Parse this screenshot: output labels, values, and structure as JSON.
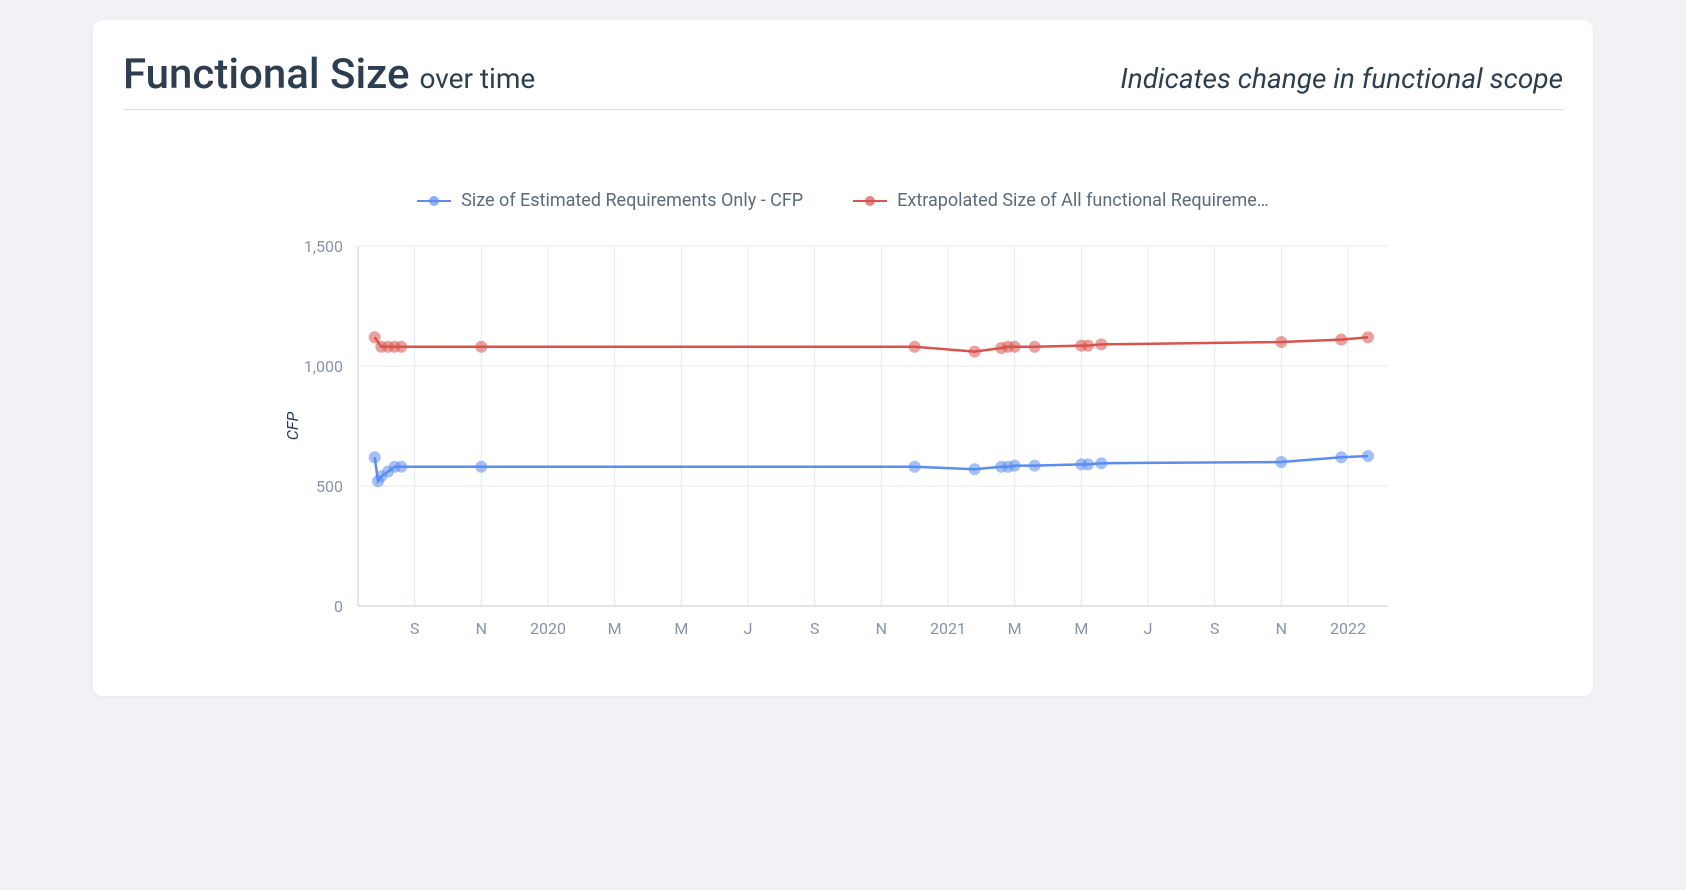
{
  "header": {
    "title_main": "Functional Size",
    "title_sub": "over time",
    "subtitle_right": "Indicates change in functional scope"
  },
  "chart_data": {
    "type": "line",
    "ylabel": "CFP",
    "xlabel": "",
    "ylim": [
      0,
      1500
    ],
    "y_ticks": [
      0,
      500,
      1000,
      1500
    ],
    "x_categories": [
      "S",
      "N",
      "2020",
      "M",
      "M",
      "J",
      "S",
      "N",
      "2021",
      "M",
      "M",
      "J",
      "S",
      "N",
      "2022"
    ],
    "legend": [
      "Size of Estimated Requirements Only - CFP",
      "Extrapolated Size of All functional Requireme…"
    ],
    "series": [
      {
        "name": "Size of Estimated Requirements Only - CFP",
        "color": "#5b8def",
        "points": [
          {
            "xi": -0.6,
            "y": 620
          },
          {
            "xi": -0.55,
            "y": 520
          },
          {
            "xi": -0.5,
            "y": 540
          },
          {
            "xi": -0.4,
            "y": 560
          },
          {
            "xi": -0.3,
            "y": 580
          },
          {
            "xi": -0.2,
            "y": 580
          },
          {
            "xi": 1,
            "y": 580
          },
          {
            "xi": 7.5,
            "y": 580
          },
          {
            "xi": 8.4,
            "y": 570
          },
          {
            "xi": 8.8,
            "y": 580
          },
          {
            "xi": 8.9,
            "y": 580
          },
          {
            "xi": 9.0,
            "y": 585
          },
          {
            "xi": 9.3,
            "y": 585
          },
          {
            "xi": 10.0,
            "y": 590
          },
          {
            "xi": 10.1,
            "y": 590
          },
          {
            "xi": 10.3,
            "y": 595
          },
          {
            "xi": 13.0,
            "y": 600
          },
          {
            "xi": 13.9,
            "y": 620
          },
          {
            "xi": 14.3,
            "y": 625
          }
        ]
      },
      {
        "name": "Extrapolated Size of All functional Requirements - CFP",
        "color": "#d9534f",
        "points": [
          {
            "xi": -0.6,
            "y": 1120
          },
          {
            "xi": -0.5,
            "y": 1080
          },
          {
            "xi": -0.4,
            "y": 1080
          },
          {
            "xi": -0.3,
            "y": 1080
          },
          {
            "xi": -0.2,
            "y": 1080
          },
          {
            "xi": 1,
            "y": 1080
          },
          {
            "xi": 7.5,
            "y": 1080
          },
          {
            "xi": 8.4,
            "y": 1060
          },
          {
            "xi": 8.8,
            "y": 1075
          },
          {
            "xi": 8.9,
            "y": 1080
          },
          {
            "xi": 9.0,
            "y": 1080
          },
          {
            "xi": 9.3,
            "y": 1080
          },
          {
            "xi": 10.0,
            "y": 1085
          },
          {
            "xi": 10.1,
            "y": 1085
          },
          {
            "xi": 10.3,
            "y": 1090
          },
          {
            "xi": 13.0,
            "y": 1100
          },
          {
            "xi": 13.9,
            "y": 1110
          },
          {
            "xi": 14.3,
            "y": 1120
          }
        ]
      }
    ]
  }
}
